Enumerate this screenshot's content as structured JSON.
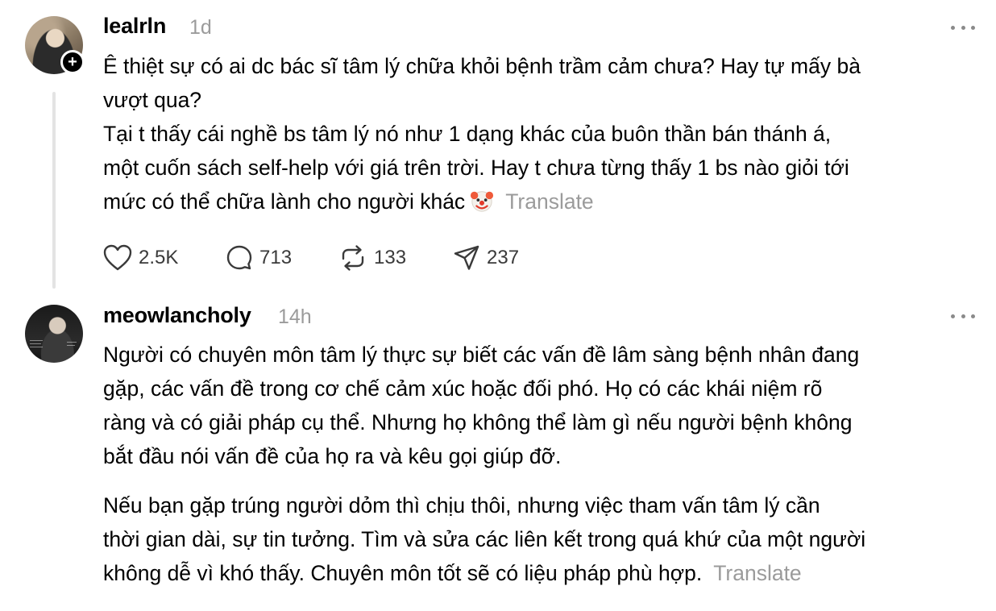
{
  "post": {
    "username": "lealrln",
    "time": "1d",
    "follow_symbol": "+",
    "text_lines": [
      "Ê thiệt sự có ai dc bác sĩ tâm lý chữa khỏi bệnh trầm cảm chưa? Hay tự mấy bà",
      "vượt qua?",
      "Tại t thấy cái nghề bs tâm lý nó như 1 dạng khác của buôn thần bán thánh á,",
      "một cuốn sách self-help với giá trên trời. Hay t chưa từng thấy 1 bs nào giỏi tới",
      "mức có thể chữa lành cho người khác"
    ],
    "emoji": "clown-face",
    "translate_label": "Translate",
    "actions": {
      "likes": "2.5K",
      "comments": "713",
      "reposts": "133",
      "shares": "237"
    }
  },
  "reply": {
    "username": "meowlancholy",
    "time": "14h",
    "paragraph1_lines": [
      "Người có chuyên môn tâm lý thực sự biết các vấn đề lâm sàng bệnh nhân đang",
      "gặp, các vấn đề trong cơ chế cảm xúc hoặc đối phó. Họ có các khái niệm rõ",
      "ràng và có giải pháp cụ thể. Nhưng họ không thể làm gì nếu người bệnh không",
      "bắt đầu nói vấn đề của họ ra và kêu gọi giúp đỡ."
    ],
    "paragraph2_lines": [
      "Nếu bạn gặp trúng người dỏm thì chịu thôi, nhưng việc tham vấn tâm lý cần",
      "thời gian dài, sự tin tưởng. Tìm và sửa các liên kết trong quá khứ của một người",
      "không dễ vì khó thấy. Chuyên môn tốt sẽ có liệu pháp phù hợp."
    ],
    "translate_label": "Translate"
  },
  "colors": {
    "text": "#000000",
    "muted": "#9b9b9b",
    "icon": "#3a3a3a",
    "thread_line": "#e3e3e3"
  }
}
